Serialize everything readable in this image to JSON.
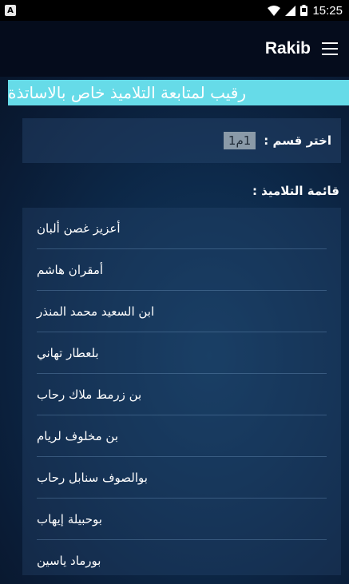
{
  "status_bar": {
    "time": "15:25",
    "notification_badge": "A",
    "icons": [
      "notification-icon",
      "wifi-icon",
      "signal-icon",
      "battery-icon"
    ]
  },
  "app_bar": {
    "title": "Rakib",
    "menu_icon": "hamburger-menu-icon"
  },
  "banner": {
    "text": "رقيب لمتابعة التلاميذ خاص بالاساتذة"
  },
  "section_picker": {
    "label": "اختر قسم :",
    "selected_value": "1م1"
  },
  "student_list": {
    "heading": "قائمة التلاميذ :",
    "items": [
      "أعزيز غصن ألبان",
      "أمقران هاشم",
      "ابن السعيد محمد المنذر",
      "بلعطار تهاني",
      "بن زرمط ملاك رحاب",
      "بن مخلوف لريام",
      "بوالصوف سنابل رحاب",
      "بوحبيلة إيهاب",
      "بورماد ياسين"
    ]
  },
  "colors": {
    "banner_bg": "#66dbe8",
    "app_bar_bg": "#050c1c",
    "status_bar_bg": "#000000",
    "select_bg": "#8a9aa8"
  }
}
